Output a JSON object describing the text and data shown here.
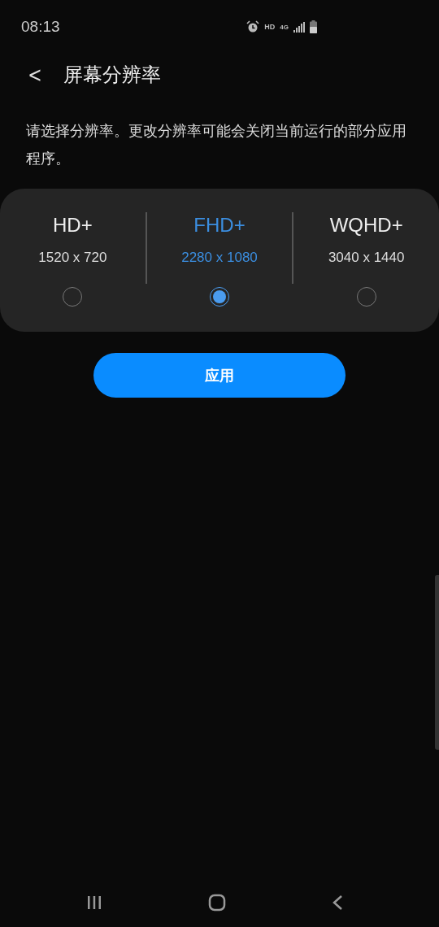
{
  "status_bar": {
    "time": "08:13",
    "hd": "HD",
    "network": "4G"
  },
  "header": {
    "back": "<",
    "title": "屏幕分辨率"
  },
  "description": "请选择分辨率。更改分辨率可能会关闭当前运行的部分应用程序。",
  "options": [
    {
      "name": "HD+",
      "resolution": "1520 x 720",
      "selected": false
    },
    {
      "name": "FHD+",
      "resolution": "2280 x 1080",
      "selected": true
    },
    {
      "name": "WQHD+",
      "resolution": "3040 x 1440",
      "selected": false
    }
  ],
  "apply_button": "应用"
}
